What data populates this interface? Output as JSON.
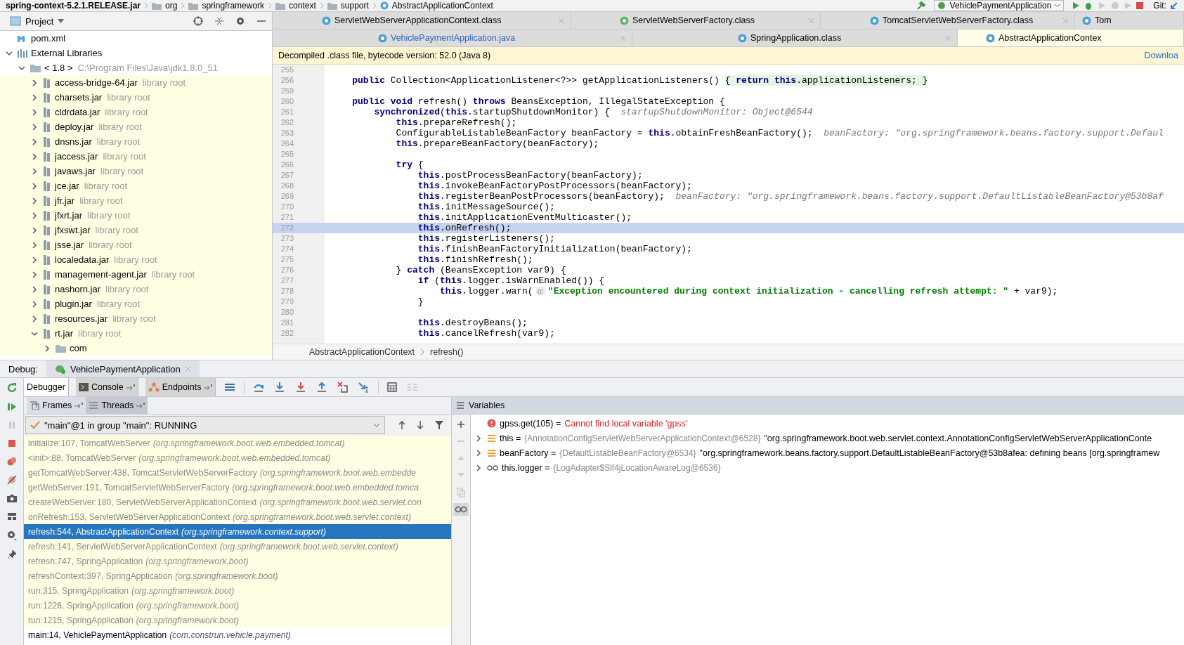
{
  "nav_bar": {
    "breadcrumbs": [
      {
        "label": "spring-context-5.2.1.RELEASE.jar",
        "kind": "jar"
      },
      {
        "label": "org",
        "kind": "package"
      },
      {
        "label": "springframework",
        "kind": "package"
      },
      {
        "label": "context",
        "kind": "package"
      },
      {
        "label": "support",
        "kind": "package"
      },
      {
        "label": "AbstractApplicationContext",
        "kind": "class"
      }
    ],
    "run_config": "VehiclePaymentApplication",
    "vcs_label": "Git:"
  },
  "project": {
    "title": "Project",
    "tree": [
      {
        "label": "pom.xml",
        "kind": "maven"
      },
      {
        "label": "External Libraries",
        "kind": "libraries",
        "expanded": true,
        "children": [
          {
            "label": "< 1.8 >",
            "note": "C:\\Program Files\\Java\\jdk1.8.0_51",
            "kind": "jdk",
            "expanded": true,
            "children": [
              {
                "label": "access-bridge-64.jar",
                "note": "library root",
                "kind": "jar",
                "expanded": false
              },
              {
                "label": "charsets.jar",
                "note": "library root",
                "kind": "jar",
                "expanded": false
              },
              {
                "label": "cldrdata.jar",
                "note": "library root",
                "kind": "jar",
                "expanded": false
              },
              {
                "label": "deploy.jar",
                "note": "library root",
                "kind": "jar",
                "expanded": false
              },
              {
                "label": "dnsns.jar",
                "note": "library root",
                "kind": "jar",
                "expanded": false
              },
              {
                "label": "jaccess.jar",
                "note": "library root",
                "kind": "jar",
                "expanded": false
              },
              {
                "label": "javaws.jar",
                "note": "library root",
                "kind": "jar",
                "expanded": false
              },
              {
                "label": "jce.jar",
                "note": "library root",
                "kind": "jar",
                "expanded": false
              },
              {
                "label": "jfr.jar",
                "note": "library root",
                "kind": "jar",
                "expanded": false
              },
              {
                "label": "jfxrt.jar",
                "note": "library root",
                "kind": "jar",
                "expanded": false
              },
              {
                "label": "jfxswt.jar",
                "note": "library root",
                "kind": "jar",
                "expanded": false
              },
              {
                "label": "jsse.jar",
                "note": "library root",
                "kind": "jar",
                "expanded": false
              },
              {
                "label": "localedata.jar",
                "note": "library root",
                "kind": "jar",
                "expanded": false
              },
              {
                "label": "management-agent.jar",
                "note": "library root",
                "kind": "jar",
                "expanded": false
              },
              {
                "label": "nashorn.jar",
                "note": "library root",
                "kind": "jar",
                "expanded": false
              },
              {
                "label": "plugin.jar",
                "note": "library root",
                "kind": "jar",
                "expanded": false
              },
              {
                "label": "resources.jar",
                "note": "library root",
                "kind": "jar",
                "expanded": false
              },
              {
                "label": "rt.jar",
                "note": "library root",
                "kind": "jar",
                "expanded": true,
                "children": [
                  {
                    "label": "com",
                    "kind": "folder",
                    "expanded": false
                  }
                ]
              }
            ]
          }
        ]
      }
    ]
  },
  "editor": {
    "tab_rows": [
      [
        {
          "label": "ServletWebServerApplicationContext.class",
          "kind": "class",
          "selected": false,
          "modified": false,
          "closable": true
        },
        {
          "label": "ServletWebServerFactory.class",
          "kind": "interface",
          "selected": false,
          "modified": false,
          "closable": true
        },
        {
          "label": "TomcatServletWebServerFactory.class",
          "kind": "class",
          "selected": false,
          "modified": false,
          "closable": true
        },
        {
          "label": "Tom",
          "kind": "class",
          "selected": false,
          "modified": false,
          "closable": false
        }
      ],
      [
        {
          "label": "VehiclePaymentApplication.java",
          "kind": "class",
          "selected": false,
          "modified": true,
          "closable": true
        },
        {
          "label": "SpringApplication.class",
          "kind": "class",
          "selected": false,
          "modified": false,
          "closable": true
        },
        {
          "label": "AbstractApplicationContex",
          "kind": "class",
          "selected": true,
          "modified": false,
          "closable": false
        }
      ]
    ],
    "banner": {
      "text": "Decompiled .class file, bytecode version: 52.0 (Java 8)",
      "link": "Downloa"
    },
    "lines": [
      {
        "number": "255",
        "current": false
      },
      {
        "number": "256",
        "current": false,
        "tokens": [
          {
            "kind": "kw",
            "text": "    public"
          },
          {
            "kind": "txt",
            "text": " Collection<ApplicationListener<?>> getApplicationListeners() "
          },
          {
            "kind": "fold",
            "text": "{ **return** **this**.applicationListeners; }"
          }
        ]
      },
      {
        "number": "259",
        "current": false
      },
      {
        "number": "260",
        "current": false,
        "tokens": [
          {
            "kind": "kw",
            "text": "    public"
          },
          {
            "kind": "kw",
            "text": " void"
          },
          {
            "kind": "txt",
            "text": " refresh() "
          },
          {
            "kind": "kw",
            "text": "throws"
          },
          {
            "kind": "txt",
            "text": " BeansException, IllegalStateException {"
          }
        ]
      },
      {
        "number": "261",
        "current": false,
        "tokens": [
          {
            "kind": "kw",
            "text": "        synchronized"
          },
          {
            "kind": "txt",
            "text": "("
          },
          {
            "kind": "kw",
            "text": "this"
          },
          {
            "kind": "txt",
            "text": ".startupShutdownMonitor) {  "
          },
          {
            "kind": "hint",
            "text": "startupShutdownMonitor: Object@6544"
          }
        ]
      },
      {
        "number": "262",
        "current": false,
        "tokens": [
          {
            "kind": "kw",
            "text": "            this"
          },
          {
            "kind": "txt",
            "text": ".prepareRefresh();"
          }
        ]
      },
      {
        "number": "263",
        "current": false,
        "tokens": [
          {
            "kind": "txt",
            "text": "            ConfigurableListableBeanFactory beanFactory = "
          },
          {
            "kind": "kw",
            "text": "this"
          },
          {
            "kind": "txt",
            "text": ".obtainFreshBeanFactory();  "
          },
          {
            "kind": "hint",
            "text": "beanFactory: \"org.springframework.beans.factory.support.Defaul"
          }
        ]
      },
      {
        "number": "264",
        "current": false,
        "tokens": [
          {
            "kind": "kw",
            "text": "            this"
          },
          {
            "kind": "txt",
            "text": ".prepareBeanFactory(beanFactory);"
          }
        ]
      },
      {
        "number": "265",
        "current": false
      },
      {
        "number": "266",
        "current": false,
        "tokens": [
          {
            "kind": "kw",
            "text": "            try"
          },
          {
            "kind": "txt",
            "text": " {"
          }
        ]
      },
      {
        "number": "267",
        "current": false,
        "tokens": [
          {
            "kind": "kw",
            "text": "                this"
          },
          {
            "kind": "txt",
            "text": ".postProcessBeanFactory(beanFactory);"
          }
        ]
      },
      {
        "number": "268",
        "current": false,
        "tokens": [
          {
            "kind": "kw",
            "text": "                this"
          },
          {
            "kind": "txt",
            "text": ".invokeBeanFactoryPostProcessors(beanFactory);"
          }
        ]
      },
      {
        "number": "269",
        "current": false,
        "tokens": [
          {
            "kind": "kw",
            "text": "                this"
          },
          {
            "kind": "txt",
            "text": ".registerBeanPostProcessors(beanFactory);  "
          },
          {
            "kind": "hint",
            "text": "beanFactory: \"org.springframework.beans.factory.support.DefaultListableBeanFactory@53b8af"
          }
        ]
      },
      {
        "number": "270",
        "current": false,
        "tokens": [
          {
            "kind": "kw",
            "text": "                this"
          },
          {
            "kind": "txt",
            "text": ".initMessageSource();"
          }
        ]
      },
      {
        "number": "271",
        "current": false,
        "tokens": [
          {
            "kind": "kw",
            "text": "                this"
          },
          {
            "kind": "txt",
            "text": ".initApplicationEventMulticaster();"
          }
        ]
      },
      {
        "number": "272",
        "current": true,
        "tokens": [
          {
            "kind": "kw",
            "text": "                this"
          },
          {
            "kind": "txt",
            "text": ".onRefresh();"
          }
        ]
      },
      {
        "number": "273",
        "current": false,
        "tokens": [
          {
            "kind": "kw",
            "text": "                this"
          },
          {
            "kind": "txt",
            "text": ".registerListeners();"
          }
        ]
      },
      {
        "number": "274",
        "current": false,
        "tokens": [
          {
            "kind": "kw",
            "text": "                this"
          },
          {
            "kind": "txt",
            "text": ".finishBeanFactoryInitialization(beanFactory);"
          }
        ]
      },
      {
        "number": "275",
        "current": false,
        "tokens": [
          {
            "kind": "kw",
            "text": "                this"
          },
          {
            "kind": "txt",
            "text": ".finishRefresh();"
          }
        ]
      },
      {
        "number": "276",
        "current": false,
        "tokens": [
          {
            "kind": "txt",
            "text": "            } "
          },
          {
            "kind": "kw",
            "text": "catch"
          },
          {
            "kind": "txt",
            "text": " (BeansException var9) {"
          }
        ]
      },
      {
        "number": "277",
        "current": false,
        "tokens": [
          {
            "kind": "kw",
            "text": "                if"
          },
          {
            "kind": "txt",
            "text": " ("
          },
          {
            "kind": "kw",
            "text": "this"
          },
          {
            "kind": "txt",
            "text": ".logger.isWarnEnabled()) {"
          }
        ]
      },
      {
        "number": "278",
        "current": false,
        "tokens": [
          {
            "kind": "kw",
            "text": "                    this"
          },
          {
            "kind": "txt",
            "text": ".logger.warn("
          },
          {
            "kind": "param",
            "text": "o:"
          },
          {
            "kind": "str",
            "text": "\"Exception encountered during context initialization - cancelling refresh attempt: \""
          },
          {
            "kind": "txt",
            "text": " + var9);"
          }
        ]
      },
      {
        "number": "279",
        "current": false,
        "tokens": [
          {
            "kind": "txt",
            "text": "                }"
          }
        ]
      },
      {
        "number": "280",
        "current": false
      },
      {
        "number": "281",
        "current": false,
        "tokens": [
          {
            "kind": "kw",
            "text": "                this"
          },
          {
            "kind": "txt",
            "text": ".destroyBeans();"
          }
        ]
      },
      {
        "number": "282",
        "current": false,
        "tokens": [
          {
            "kind": "kw",
            "text": "                this"
          },
          {
            "kind": "txt",
            "text": ".cancelRefresh(var9);"
          }
        ]
      }
    ],
    "breadcrumb": [
      "AbstractApplicationContext",
      "refresh()"
    ]
  },
  "debug": {
    "label": "Debug:",
    "session": "VehiclePaymentApplication",
    "tabs": [
      {
        "label": "Debugger",
        "selected": true,
        "pinned": false
      },
      {
        "label": "Console",
        "selected": false,
        "pinned": true
      },
      {
        "label": "Endpoints",
        "selected": false,
        "pinned": true
      }
    ],
    "frame_tabs": [
      {
        "label": "Frames",
        "selected": true
      },
      {
        "label": "Threads",
        "selected": false
      }
    ],
    "thread": "\"main\"@1 in group \"main\": RUNNING",
    "frames": [
      {
        "method": "initialize:107, TomcatWebServer",
        "package": "(org.springframework.boot.web.embedded.tomcat)",
        "library": true,
        "selected": false
      },
      {
        "method": "<init>:88, TomcatWebServer",
        "package": "(org.springframework.boot.web.embedded.tomcat)",
        "library": true,
        "selected": false
      },
      {
        "method": "getTomcatWebServer:438, TomcatServletWebServerFactory",
        "package": "(org.springframework.boot.web.embedde",
        "library": true,
        "selected": false
      },
      {
        "method": "getWebServer:191, TomcatServletWebServerFactory",
        "package": "(org.springframework.boot.web.embedded.tomca",
        "library": true,
        "selected": false
      },
      {
        "method": "createWebServer:180, ServletWebServerApplicationContext",
        "package": "(org.springframework.boot.web.servlet.con",
        "library": true,
        "selected": false
      },
      {
        "method": "onRefresh:153, ServletWebServerApplicationContext",
        "package": "(org.springframework.boot.web.servlet.context)",
        "library": true,
        "selected": false
      },
      {
        "method": "refresh:544, AbstractApplicationContext",
        "package": "(org.springframework.context.support)",
        "library": true,
        "selected": true
      },
      {
        "method": "refresh:141, ServletWebServerApplicationContext",
        "package": "(org.springframework.boot.web.servlet.context)",
        "library": true,
        "selected": false
      },
      {
        "method": "refresh:747, SpringApplication",
        "package": "(org.springframework.boot)",
        "library": true,
        "selected": false
      },
      {
        "method": "refreshContext:397, SpringApplication",
        "package": "(org.springframework.boot)",
        "library": true,
        "selected": false
      },
      {
        "method": "run:315, SpringApplication",
        "package": "(org.springframework.boot)",
        "library": true,
        "selected": false
      },
      {
        "method": "run:1226, SpringApplication",
        "package": "(org.springframework.boot)",
        "library": true,
        "selected": false
      },
      {
        "method": "run:1215, SpringApplication",
        "package": "(org.springframework.boot)",
        "library": true,
        "selected": false
      },
      {
        "method": "main:14, VehiclePaymentApplication",
        "package": "(com.construn.vehicle.payment)",
        "library": false,
        "selected": false
      }
    ],
    "variables_title": "Variables",
    "variables": [
      {
        "kind": "error",
        "expandable": false,
        "name": "gpss.get(105) =",
        "value": "Cannot find local variable 'gpss'"
      },
      {
        "kind": "field",
        "expandable": true,
        "name": "this =",
        "type": "{AnnotationConfigServletWebServerApplicationContext@6528}",
        "value": "\"org.springframework.boot.web.servlet.context.AnnotationConfigServletWebServerApplicationConte"
      },
      {
        "kind": "field",
        "expandable": true,
        "name": "beanFactory =",
        "type": "{DefaultListableBeanFactory@6534}",
        "value": "\"org.springframework.beans.factory.support.DefaultListableBeanFactory@53b8afea: defining beans [org.springframew"
      },
      {
        "kind": "watch",
        "expandable": true,
        "name": "this.logger =",
        "type": "{LogAdapter$Slf4jLocationAwareLog@6536}"
      }
    ]
  }
}
